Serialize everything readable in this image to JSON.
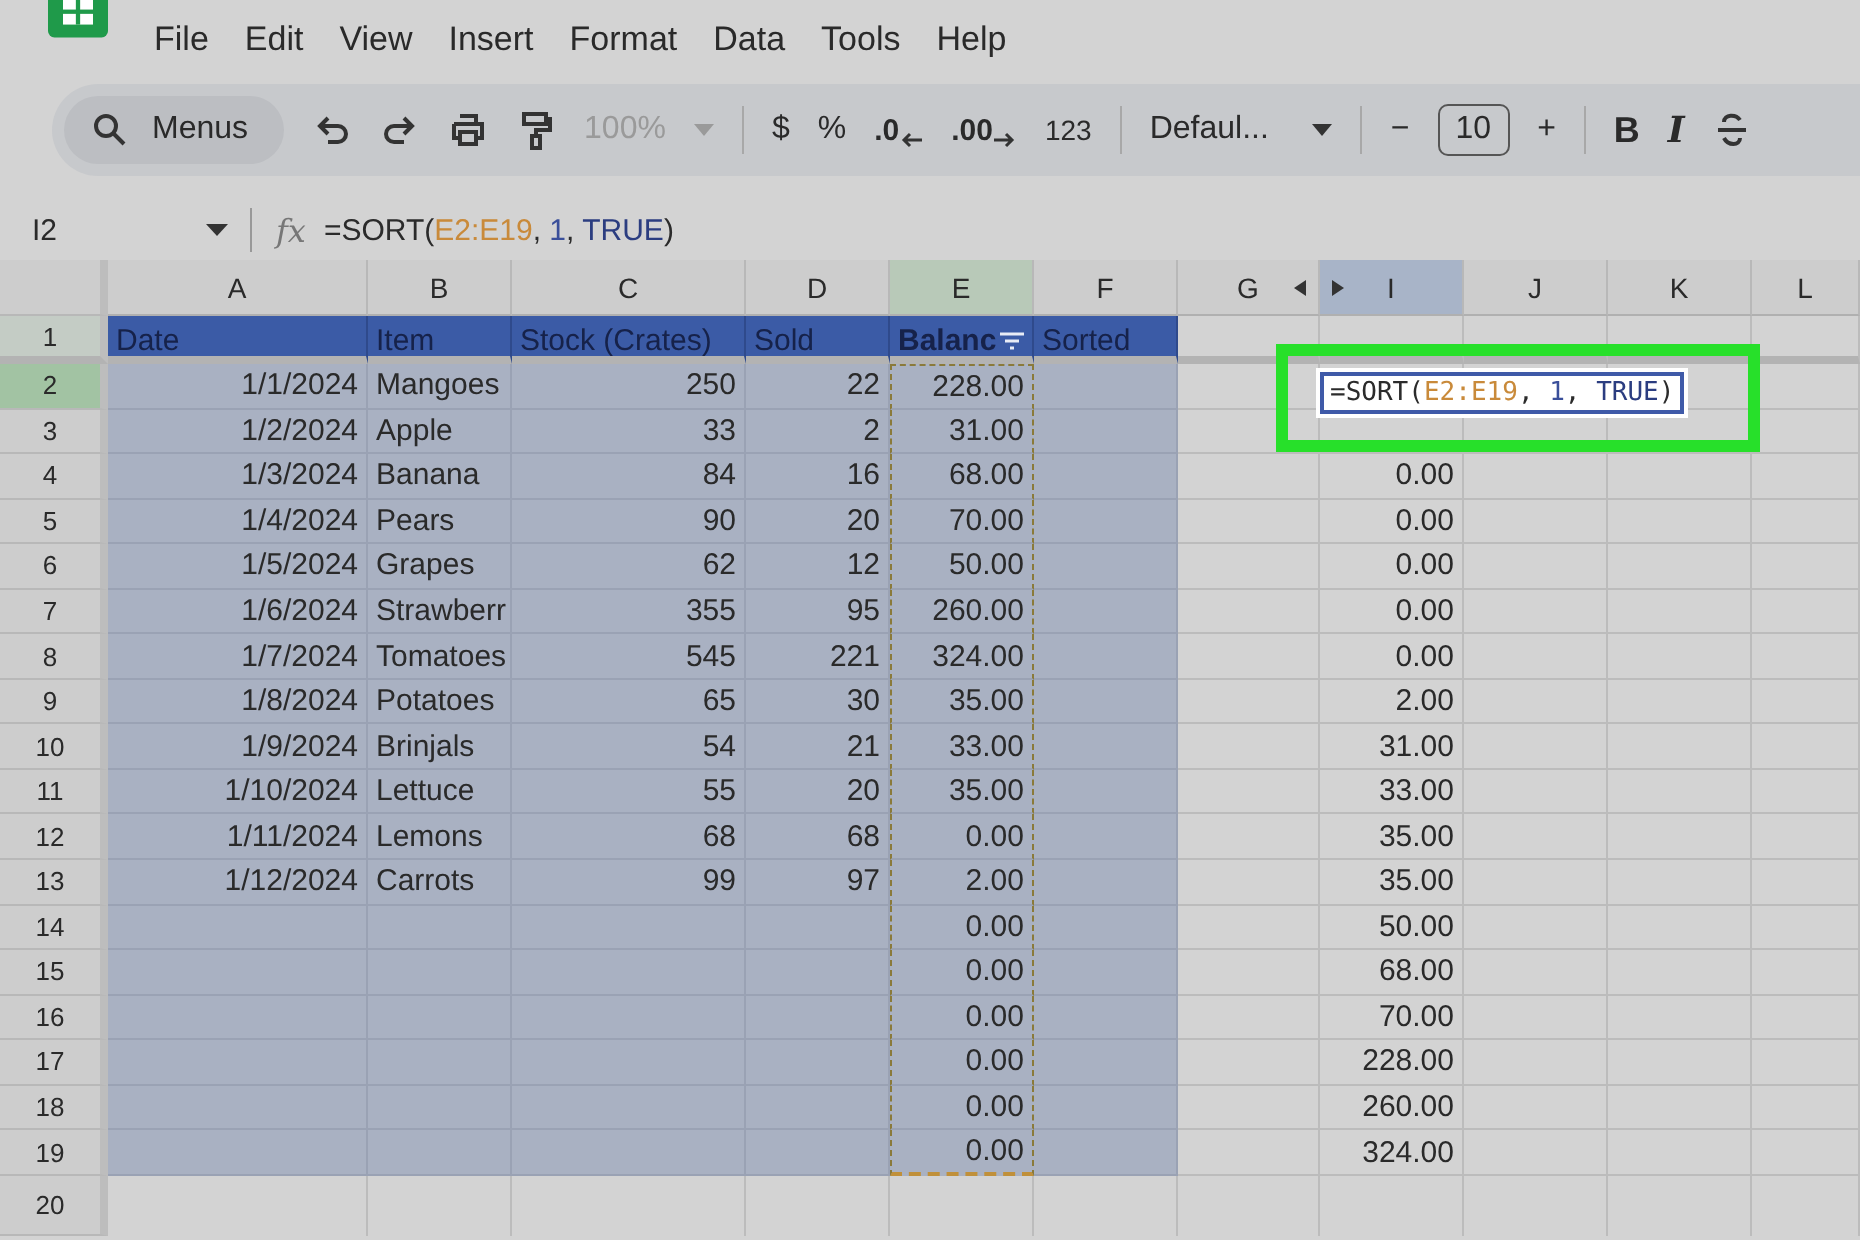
{
  "menu_bar": {
    "items": [
      "File",
      "Edit",
      "View",
      "Insert",
      "Format",
      "Data",
      "Tools",
      "Help"
    ]
  },
  "toolbar": {
    "search": {
      "label": "Menus"
    },
    "zoom": {
      "value": "100%",
      "disabled": true
    },
    "currency": "$",
    "percent": "%",
    "decrease_decimals": ".0",
    "increase_decimals": ".00",
    "more_formats": "123",
    "font": "Defaul...",
    "font_size": "10",
    "decrease_size": "−",
    "increase_size": "+",
    "bold": "B",
    "italic": "I"
  },
  "formula_bar": {
    "name_box": "I2",
    "function_label": "fx",
    "tokens": [
      {
        "text": "=SORT(",
        "kind": "plain"
      },
      {
        "text": "E2:E19",
        "kind": "range"
      },
      {
        "text": ", ",
        "kind": "plain"
      },
      {
        "text": "1",
        "kind": "number"
      },
      {
        "text": ", ",
        "kind": "plain"
      },
      {
        "text": "TRUE",
        "kind": "bool"
      },
      {
        "text": ")",
        "kind": "plain"
      }
    ]
  },
  "columns": [
    {
      "label": "A",
      "kind": "number",
      "in_selection": true,
      "selected": false,
      "editing": false,
      "copied": false,
      "filter": false
    },
    {
      "label": "B",
      "kind": "text",
      "in_selection": true,
      "selected": false,
      "editing": false,
      "copied": false,
      "filter": false
    },
    {
      "label": "C",
      "kind": "number",
      "in_selection": true,
      "selected": false,
      "editing": false,
      "copied": false,
      "filter": false
    },
    {
      "label": "D",
      "kind": "number",
      "in_selection": true,
      "selected": false,
      "editing": false,
      "copied": false,
      "filter": false
    },
    {
      "label": "E",
      "kind": "number",
      "in_selection": true,
      "selected": true,
      "editing": false,
      "copied": true,
      "filter": true
    },
    {
      "label": "F",
      "kind": "text",
      "in_selection": true,
      "selected": false,
      "editing": false,
      "copied": false,
      "filter": false
    },
    {
      "label": "G",
      "kind": "number",
      "in_selection": false,
      "selected": false,
      "editing": false,
      "copied": false,
      "filter": false,
      "hidden_after": true
    },
    {
      "label": "I",
      "kind": "number",
      "in_selection": false,
      "selected": false,
      "editing": true,
      "copied": false,
      "filter": false,
      "hidden_before": true
    },
    {
      "label": "J",
      "kind": "number",
      "in_selection": false,
      "selected": false,
      "editing": false,
      "copied": false,
      "filter": false
    },
    {
      "label": "K",
      "kind": "number",
      "in_selection": false,
      "selected": false,
      "editing": false,
      "copied": false,
      "filter": false
    },
    {
      "label": "L",
      "kind": "number",
      "in_selection": false,
      "selected": false,
      "editing": false,
      "copied": false,
      "filter": false
    }
  ],
  "rows": [
    {
      "number": "1",
      "kind": "header",
      "selected": true,
      "highlight": false,
      "cells": [
        "Date",
        "Item",
        "Stock (Crates)",
        "Sold",
        "Balanc",
        "Sorted",
        "",
        "",
        "",
        "",
        ""
      ]
    },
    {
      "number": "2",
      "kind": "data",
      "selected": true,
      "highlight": true,
      "cells": [
        "1/1/2024",
        "Mangoes",
        "250",
        "22",
        "228.00",
        "",
        "",
        "",
        "",
        "",
        ""
      ]
    },
    {
      "number": "3",
      "kind": "data",
      "selected": true,
      "highlight": false,
      "cells": [
        "1/2/2024",
        "Apple",
        "33",
        "2",
        "31.00",
        "",
        "",
        "",
        "",
        "",
        ""
      ]
    },
    {
      "number": "4",
      "kind": "data",
      "selected": true,
      "highlight": false,
      "cells": [
        "1/3/2024",
        "Banana",
        "84",
        "16",
        "68.00",
        "",
        "",
        "0.00",
        "",
        "",
        ""
      ]
    },
    {
      "number": "5",
      "kind": "data",
      "selected": true,
      "highlight": false,
      "cells": [
        "1/4/2024",
        "Pears",
        "90",
        "20",
        "70.00",
        "",
        "",
        "0.00",
        "",
        "",
        ""
      ]
    },
    {
      "number": "6",
      "kind": "data",
      "selected": true,
      "highlight": false,
      "cells": [
        "1/5/2024",
        "Grapes",
        "62",
        "12",
        "50.00",
        "",
        "",
        "0.00",
        "",
        "",
        ""
      ]
    },
    {
      "number": "7",
      "kind": "data",
      "selected": true,
      "highlight": false,
      "cells": [
        "1/6/2024",
        "Strawberr",
        "355",
        "95",
        "260.00",
        "",
        "",
        "0.00",
        "",
        "",
        ""
      ]
    },
    {
      "number": "8",
      "kind": "data",
      "selected": true,
      "highlight": false,
      "cells": [
        "1/7/2024",
        "Tomatoes",
        "545",
        "221",
        "324.00",
        "",
        "",
        "0.00",
        "",
        "",
        ""
      ]
    },
    {
      "number": "9",
      "kind": "data",
      "selected": true,
      "highlight": false,
      "cells": [
        "1/8/2024",
        "Potatoes",
        "65",
        "30",
        "35.00",
        "",
        "",
        "2.00",
        "",
        "",
        ""
      ]
    },
    {
      "number": "10",
      "kind": "data",
      "selected": true,
      "highlight": false,
      "cells": [
        "1/9/2024",
        "Brinjals",
        "54",
        "21",
        "33.00",
        "",
        "",
        "31.00",
        "",
        "",
        ""
      ]
    },
    {
      "number": "11",
      "kind": "data",
      "selected": true,
      "highlight": false,
      "cells": [
        "1/10/2024",
        "Lettuce",
        "55",
        "20",
        "35.00",
        "",
        "",
        "33.00",
        "",
        "",
        ""
      ]
    },
    {
      "number": "12",
      "kind": "data",
      "selected": true,
      "highlight": false,
      "cells": [
        "1/11/2024",
        "Lemons",
        "68",
        "68",
        "0.00",
        "",
        "",
        "35.00",
        "",
        "",
        ""
      ]
    },
    {
      "number": "13",
      "kind": "data",
      "selected": true,
      "highlight": false,
      "cells": [
        "1/12/2024",
        "Carrots",
        "99",
        "97",
        "2.00",
        "",
        "",
        "35.00",
        "",
        "",
        ""
      ]
    },
    {
      "number": "14",
      "kind": "data",
      "selected": true,
      "highlight": false,
      "cells": [
        "",
        "",
        "",
        "",
        "0.00",
        "",
        "",
        "50.00",
        "",
        "",
        ""
      ]
    },
    {
      "number": "15",
      "kind": "data",
      "selected": true,
      "highlight": false,
      "cells": [
        "",
        "",
        "",
        "",
        "0.00",
        "",
        "",
        "68.00",
        "",
        "",
        ""
      ]
    },
    {
      "number": "16",
      "kind": "data",
      "selected": true,
      "highlight": false,
      "cells": [
        "",
        "",
        "",
        "",
        "0.00",
        "",
        "",
        "70.00",
        "",
        "",
        ""
      ]
    },
    {
      "number": "17",
      "kind": "data",
      "selected": true,
      "highlight": false,
      "cells": [
        "",
        "",
        "",
        "",
        "0.00",
        "",
        "",
        "228.00",
        "",
        "",
        ""
      ]
    },
    {
      "number": "18",
      "kind": "data",
      "selected": true,
      "highlight": false,
      "cells": [
        "",
        "",
        "",
        "",
        "0.00",
        "",
        "",
        "260.00",
        "",
        "",
        ""
      ]
    },
    {
      "number": "19",
      "kind": "data",
      "selected": true,
      "highlight": false,
      "cells": [
        "",
        "",
        "",
        "",
        "0.00",
        "",
        "",
        "324.00",
        "",
        "",
        ""
      ]
    },
    {
      "number": "20",
      "kind": "data",
      "selected": false,
      "highlight": false,
      "cells": [
        "",
        "",
        "",
        "",
        "",
        "",
        "",
        "",
        "",
        "",
        ""
      ]
    }
  ],
  "cell_editor": {
    "tokens": [
      {
        "text": "=SORT(",
        "kind": "plain"
      },
      {
        "text": "E2:E19",
        "kind": "range"
      },
      {
        "text": ", ",
        "kind": "plain"
      },
      {
        "text": "1",
        "kind": "number"
      },
      {
        "text": ", ",
        "kind": "plain"
      },
      {
        "text": "TRUE",
        "kind": "bool"
      },
      {
        "text": ")",
        "kind": "plain"
      }
    ],
    "callout": true
  }
}
